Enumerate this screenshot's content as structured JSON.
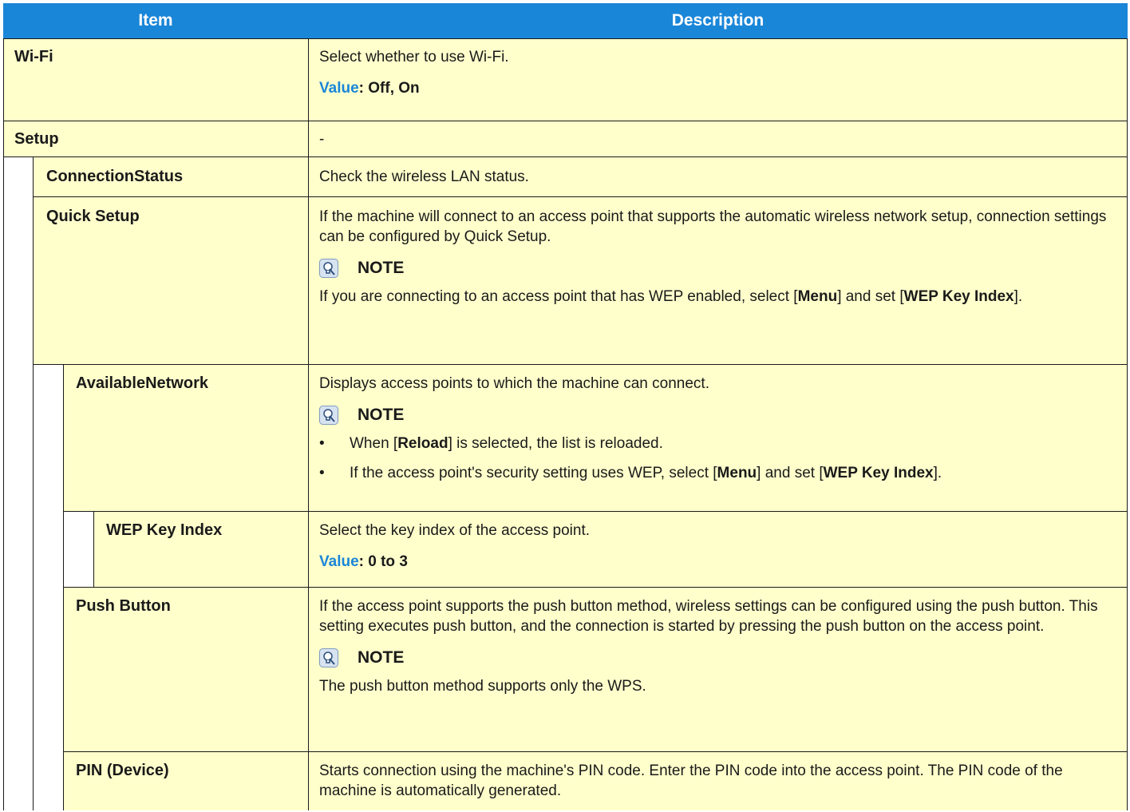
{
  "header": {
    "item": "Item",
    "description": "Description"
  },
  "rows": [
    {
      "item": "Wi-Fi",
      "description": "Select whether to use Wi-Fi.",
      "value_label": "Value",
      "value_text": ": Off, On"
    },
    {
      "item": "Setup",
      "description": "-"
    },
    {
      "item": "ConnectionStatus",
      "description": "Check the wireless LAN status."
    },
    {
      "item": "Quick Setup",
      "description": "If the machine will connect to an access point that supports the automatic wireless network setup, connection settings can be configured by Quick Setup.",
      "note_label": "NOTE",
      "note_parts": [
        "If you are connecting to an access point that has WEP enabled, select [",
        "Menu",
        "] and set [",
        "WEP Key Index",
        "]."
      ]
    },
    {
      "item": "AvailableNetwork",
      "description": "Displays access points to which the machine can connect.",
      "note_label": "NOTE",
      "bullet1": [
        "When [",
        "Reload",
        "] is selected, the list is reloaded."
      ],
      "bullet2": [
        "If the access point's security setting uses WEP, select [",
        "Menu",
        "] and set [",
        "WEP Key Index",
        "]."
      ]
    },
    {
      "item": "WEP Key Index",
      "description": "Select the key index of the access point.",
      "value_label": "Value",
      "value_text": ": 0 to 3"
    },
    {
      "item": "Push Button",
      "description": "If the access point supports the push button method, wireless settings can be configured using the push button. This setting executes push button, and the connection is started by pressing the push button on the access point.",
      "note_label": "NOTE",
      "note_text": "The push button method supports only the WPS."
    },
    {
      "item": "PIN (Device)",
      "description": "Starts connection using the machine's PIN code. Enter the PIN code into the access point. The PIN code of the machine is automatically generated."
    }
  ],
  "colors": {
    "header_bg": "#1a86d8",
    "value_label": "#1a86d8",
    "row_bg": "#ffffcc",
    "border": "#1a1a1a"
  },
  "icons": {
    "note": "lightbulb-note-icon"
  }
}
